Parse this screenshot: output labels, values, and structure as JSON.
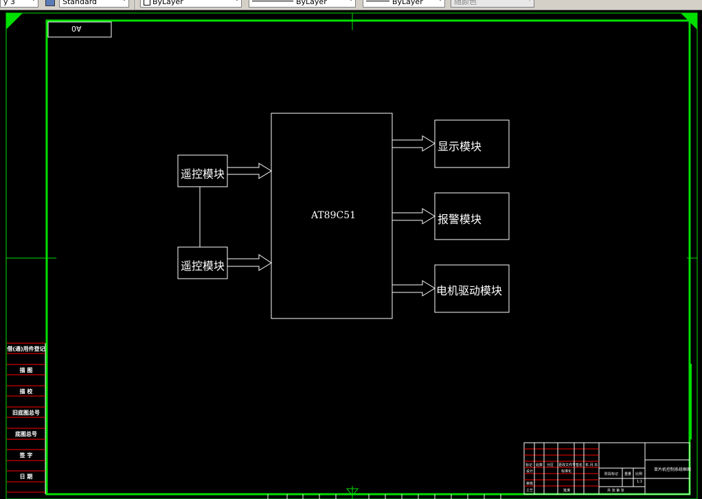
{
  "toolbar": {
    "plot_style_partial": "y 3",
    "text_style": "Standard",
    "layer_value": "ByLayer",
    "linetype_value": "ByLayer",
    "lineweight_value": "ByLayer",
    "plot_style": "随颜色"
  },
  "sheet": {
    "sheet_code_box": "A0"
  },
  "diagram": {
    "mcu_label": "AT89C51",
    "inputs": [
      {
        "label": "遥控模块"
      },
      {
        "label": "遥控模块"
      }
    ],
    "outputs": [
      {
        "label": "显示模块"
      },
      {
        "label": "报警模块"
      },
      {
        "label": "电机驱动模块"
      }
    ]
  },
  "side_table": {
    "rows": [
      "借(通)用件登记",
      "描 图",
      "描 校",
      "旧底图总号",
      "底图总号",
      "签 字",
      "日 期"
    ]
  },
  "title_block": {
    "cells": [
      "标记",
      "处数",
      "分区",
      "更改文件号",
      "签名",
      "年.月.日",
      "设计",
      "标准化",
      "审核",
      "工艺",
      "批准",
      "阶段标记",
      "重量",
      "比例",
      "1:1",
      "共 张 第 张"
    ],
    "title_text": "单片机控制系统框图"
  },
  "colors": {
    "frame_green": "#00e000",
    "line_white": "#ffffff",
    "table_red": "#ff0000",
    "background": "#000000"
  },
  "icons": [
    "dropdown-arrow-icon",
    "layer-properties-icon",
    "center-mark-icon"
  ]
}
